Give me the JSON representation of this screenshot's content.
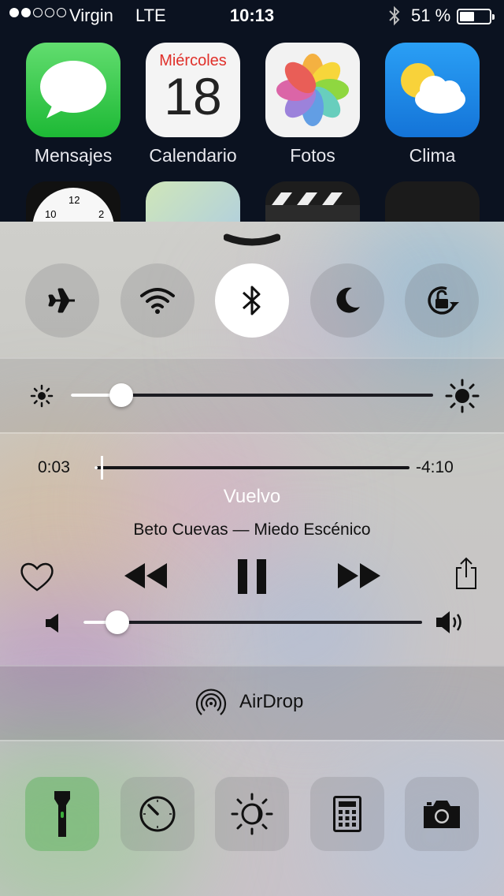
{
  "status_bar": {
    "signal_dots": [
      true,
      true,
      false,
      false,
      false
    ],
    "carrier": "Virgin",
    "network": "LTE",
    "time": "10:13",
    "bluetooth_icon": "bluetooth-icon",
    "battery_percent": "51 %",
    "battery_level": 0.51
  },
  "home_apps": [
    {
      "label": "Mensajes",
      "icon": "messages-icon",
      "color": "#34c759"
    },
    {
      "label": "Calendario",
      "icon": "calendar-icon",
      "day": "Miércoles",
      "date": "18"
    },
    {
      "label": "Fotos",
      "icon": "photos-icon"
    },
    {
      "label": "Clima",
      "icon": "weather-icon",
      "color": "#1e8cf0"
    }
  ],
  "control_center": {
    "grabber_icon": "chevron-down-icon",
    "toggles": [
      {
        "name": "airplane-mode",
        "icon": "airplane-icon",
        "on": false
      },
      {
        "name": "wifi",
        "icon": "wifi-icon",
        "on": false
      },
      {
        "name": "bluetooth",
        "icon": "bluetooth-icon",
        "on": true
      },
      {
        "name": "do-not-disturb",
        "icon": "moon-icon",
        "on": false
      },
      {
        "name": "rotation-lock",
        "icon": "rotation-lock-icon",
        "on": false
      }
    ],
    "brightness": {
      "level": 0.14
    },
    "music": {
      "elapsed": "0:03",
      "remaining": "-4:10",
      "progress": 0.01,
      "title": "Vuelvo",
      "subtitle": "Beto Cuevas — Miedo Escénico",
      "volume": 0.1
    },
    "airdrop": {
      "label": "AirDrop"
    },
    "tools": [
      {
        "name": "flashlight",
        "icon": "flashlight-icon",
        "on": true
      },
      {
        "name": "timer",
        "icon": "timer-icon",
        "on": false
      },
      {
        "name": "night-shift",
        "icon": "night-shift-icon",
        "on": false
      },
      {
        "name": "calculator",
        "icon": "calculator-icon",
        "on": false
      },
      {
        "name": "camera",
        "icon": "camera-icon",
        "on": false
      }
    ]
  }
}
